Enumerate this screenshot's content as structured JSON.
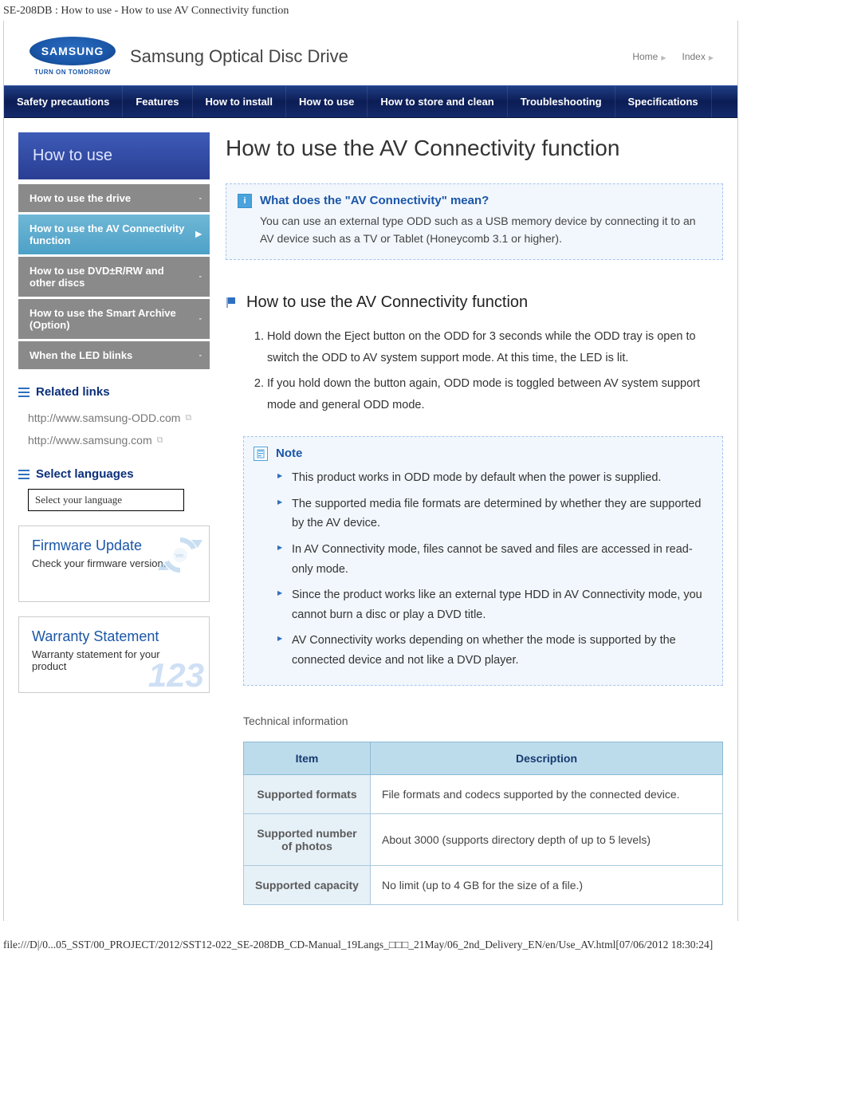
{
  "page_path_top": "SE-208DB : How to use - How to use AV Connectivity function",
  "page_path_bottom": "file:///D|/0...05_SST/00_PROJECT/2012/SST12-022_SE-208DB_CD-Manual_19Langs_□□□_21May/06_2nd_Delivery_EN/en/Use_AV.html[07/06/2012 18:30:24]",
  "brand": {
    "logo_text": "SAMSUNG",
    "tagline": "TURN ON TOMORROW",
    "product_title": "Samsung Optical Disc Drive"
  },
  "topnav": {
    "home": "Home",
    "index": "Index"
  },
  "menu": {
    "items": [
      "Safety precautions",
      "Features",
      "How to install",
      "How to use",
      "How to store and clean",
      "Troubleshooting",
      "Specifications"
    ]
  },
  "sidebar": {
    "title": "How to use",
    "items": [
      {
        "label": "How to use the drive",
        "chev": "-"
      },
      {
        "label": "How to use the AV Connectivity function",
        "active": true,
        "chev": "▶"
      },
      {
        "label": "How to use DVD±R/RW and other discs",
        "chev": "-"
      },
      {
        "label": "How to use the Smart Archive (Option)",
        "chev": "-"
      },
      {
        "label": "When the LED blinks",
        "chev": "-"
      }
    ],
    "related_heading": "Related links",
    "related_links": [
      "http://www.samsung-ODD.com",
      "http://www.samsung.com"
    ],
    "lang_heading": "Select languages",
    "lang_selected": "Select your language",
    "cards": {
      "firmware": {
        "title": "Firmware Update",
        "desc": "Check your firmware version.",
        "badge": "Ver."
      },
      "warranty": {
        "title": "Warranty Statement",
        "desc": "Warranty statement for your product",
        "num": "123"
      }
    }
  },
  "main": {
    "h1": "How to use the AV Connectivity function",
    "info": {
      "title": "What does the \"AV Connectivity\" mean?",
      "text": "You can use an external type ODD such as a USB memory device by connecting it to an AV device such as a TV or Tablet (Honeycomb 3.1 or higher)."
    },
    "section_heading": "How to use the AV Connectivity function",
    "steps": [
      "Hold down the Eject button on the ODD for 3 seconds while the ODD tray is open to switch the ODD to AV system support mode. At this time, the LED is lit.",
      "If you hold down the button again, ODD mode is toggled between AV system support mode and general ODD mode."
    ],
    "note": {
      "title": "Note",
      "bullets": [
        "This product works in ODD mode by default when the power is supplied.",
        "The supported media file formats are determined by whether they are supported by the AV device.",
        "In AV Connectivity mode, files cannot be saved and files are accessed in read-only mode.",
        "Since the product works like an external type HDD in AV Connectivity mode, you cannot burn a disc or play a DVD title.",
        "AV Connectivity works depending on whether the mode is supported by the connected device and not like a DVD player."
      ]
    },
    "tech_heading": "Technical information",
    "table": {
      "headers": {
        "item": "Item",
        "desc": "Description"
      },
      "rows": [
        {
          "item": "Supported formats",
          "desc": "File formats and codecs supported by the connected device."
        },
        {
          "item": "Supported number of photos",
          "desc": "About 3000 (supports directory depth of up to 5 levels)"
        },
        {
          "item": "Supported capacity",
          "desc": "No limit (up to 4 GB for the size of a file.)"
        }
      ]
    }
  }
}
